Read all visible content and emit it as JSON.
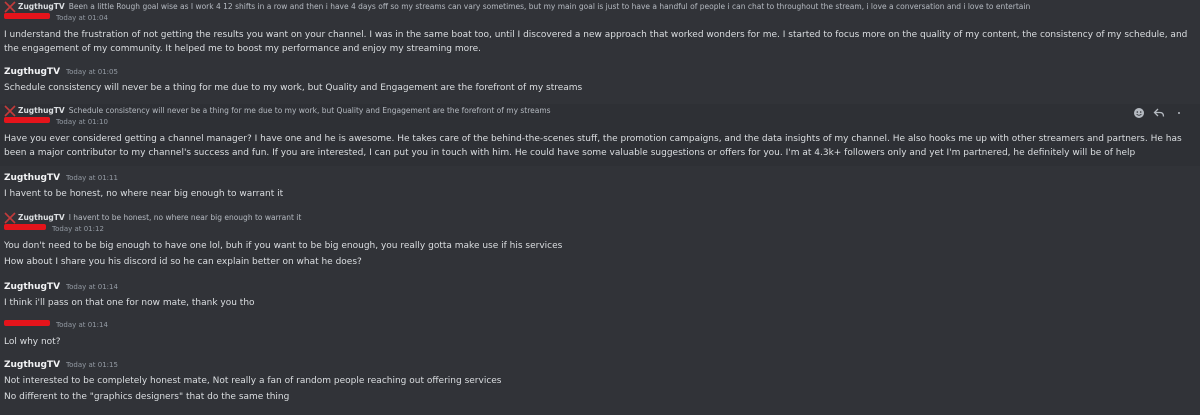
{
  "messages": [
    {
      "reply": {
        "author": "ZugthugTV",
        "text": "Been a little Rough goal wise as I work 4 12 shifts in a row and then i have 4 days off so my streams can vary sometimes, but my main goal is just to have a handful of people i can chat to throughout the stream, i love a conversation and i love to entertain"
      },
      "author": "",
      "author_redacted": true,
      "timestamp": "Today at 01:04",
      "lines": [
        "I understand the frustration of not getting the results you want on your channel. I was in the same boat too, until I discovered a new approach that worked wonders for me. I started to focus more on the quality of my content, the consistency of my schedule, and the engagement of my community. It helped me to boost my performance and enjoy my streaming more."
      ]
    },
    {
      "author": "ZugthugTV",
      "timestamp": "Today at 01:05",
      "lines": [
        "Schedule consistency will never be a thing for me due to my work, but Quality and Engagement are the forefront of my streams"
      ]
    },
    {
      "reply": {
        "author": "ZugthugTV",
        "text": "Schedule consistency will never be a thing for me due to my work, but Quality and Engagement are the forefront of my streams"
      },
      "author": "",
      "author_redacted": true,
      "timestamp": "Today at 01:10",
      "lines": [
        "Have you ever considered getting a channel manager? I have one and he is awesome. He takes care of the behind-the-scenes stuff, the promotion campaigns, and the data insights of my channel. He also hooks me up with other streamers and partners. He has been a major contributor to my channel's success and fun. If you are interested, I can put you in touch with him. He could have some valuable suggestions or offers for you. I'm at 4.3k+ followers only and yet I'm partnered, he definitely will be of help"
      ]
    },
    {
      "author": "ZugthugTV",
      "timestamp": "Today at 01:11",
      "lines": [
        "I havent to be honest, no where near big enough to warrant it"
      ]
    },
    {
      "reply": {
        "author": "ZugthugTV",
        "text": "I havent to be honest, no where near big enough to warrant it"
      },
      "author": "",
      "author_redacted": true,
      "timestamp": "Today at 01:12",
      "lines": [
        "You don't need to be big enough to have one lol, buh if you want to be big enough, you really gotta make use if his services",
        "How about I share you his discord id so he can explain better on what he does?"
      ]
    },
    {
      "author": "ZugthugTV",
      "timestamp": "Today at 01:14",
      "lines": [
        "I think i'll pass on that one for now mate, thank you tho"
      ]
    },
    {
      "author": "",
      "author_redacted": true,
      "timestamp": "Today at 01:14",
      "lines": [
        "Lol why not?"
      ]
    },
    {
      "author": "ZugthugTV",
      "timestamp": "Today at 01:15",
      "lines": [
        "Not interested to be completely honest mate, Not really a fan of random people reaching out offering services",
        "No different to the \"graphics designers\" that do the same thing"
      ]
    }
  ],
  "toolbar": {
    "icons": [
      "add-reaction-icon",
      "reply-icon",
      "more-icon"
    ]
  },
  "colors": {
    "background": "#313338",
    "hover_background": "#2e3035",
    "redaction": "#e5141b",
    "text": "#dbdee1",
    "timestamp": "#949ba4"
  }
}
